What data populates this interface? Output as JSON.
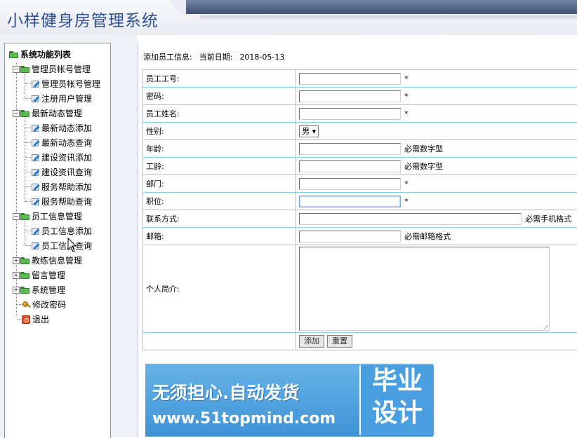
{
  "app": {
    "title": "小样健身房管理系统"
  },
  "sidebar": {
    "root_label": "系统功能列表",
    "items": [
      {
        "label": "管理员帐号管理",
        "type": "folder",
        "expanded": true
      },
      {
        "label": "管理员帐号管理",
        "type": "page"
      },
      {
        "label": "注册用户管理",
        "type": "page"
      },
      {
        "label": "最新动态管理",
        "type": "folder",
        "expanded": true
      },
      {
        "label": "最新动态添加",
        "type": "page"
      },
      {
        "label": "最新动态查询",
        "type": "page"
      },
      {
        "label": "建设资讯添加",
        "type": "page"
      },
      {
        "label": "建设资讯查询",
        "type": "page"
      },
      {
        "label": "服务帮助添加",
        "type": "page"
      },
      {
        "label": "服务帮助查询",
        "type": "page"
      },
      {
        "label": "员工信息管理",
        "type": "folder",
        "expanded": true
      },
      {
        "label": "员工信息添加",
        "type": "page"
      },
      {
        "label": "员工信息查询",
        "type": "page"
      },
      {
        "label": "教练信息管理",
        "type": "folder",
        "expanded": false
      },
      {
        "label": "留言管理",
        "type": "folder",
        "expanded": false
      },
      {
        "label": "系统管理",
        "type": "folder",
        "expanded": false
      },
      {
        "label": "修改密码",
        "type": "key"
      },
      {
        "label": "退出",
        "type": "exit"
      }
    ]
  },
  "main": {
    "heading": "添加员工信息:",
    "date_label": "当前日期:",
    "date_value": "2018-05-13",
    "form": {
      "rows": [
        {
          "label": "员工工号:",
          "note": "*"
        },
        {
          "label": "密码:",
          "note": "*"
        },
        {
          "label": "员工姓名:",
          "note": "*"
        },
        {
          "label": "性别:",
          "select_value": "男"
        },
        {
          "label": "年龄:",
          "note": "必需数字型"
        },
        {
          "label": "工龄:",
          "note": "必需数字型"
        },
        {
          "label": "部门:",
          "note": "*"
        },
        {
          "label": "职位:",
          "note": "*"
        },
        {
          "label": "联系方式:",
          "note": "必需手机格式"
        },
        {
          "label": "邮箱:",
          "note": "必需邮箱格式"
        },
        {
          "label": "个人简介:"
        }
      ],
      "submit_label": "添加",
      "reset_label": "重置"
    }
  },
  "banner": {
    "line1": "无须担心.自动发货",
    "line2": "www.51topmind.com",
    "side_top": "毕业",
    "side_bottom": "设计"
  },
  "colors": {
    "title": "#2c4f96",
    "table_border": "#7fd6e6",
    "folder_green": "#5bbb4e",
    "banner_blue": "#4a9fe0"
  }
}
